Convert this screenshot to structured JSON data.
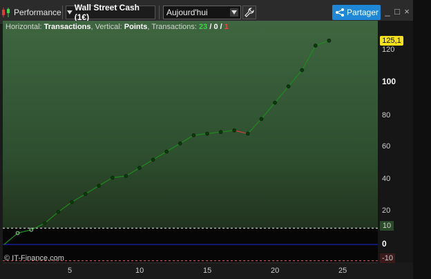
{
  "toolbar": {
    "performance_label": "Performance",
    "instrument_label": "Wall Street Cash (1€)",
    "period_label": "Aujourd'hui",
    "share_label": "Partager"
  },
  "info": {
    "horizontal_prefix": "Horizontal: ",
    "horizontal_value": "Transactions",
    "vertical_prefix": ", Vertical: ",
    "vertical_value": "Points",
    "transactions_prefix": ", Transactions: ",
    "count_green": "23",
    "sep1": " / ",
    "count_white": "0",
    "sep2": " / ",
    "count_red": "1"
  },
  "copyright": "© IT-Finance.com",
  "chart_data": {
    "type": "line",
    "xlabel": "",
    "ylabel": "",
    "xlim": [
      0,
      28
    ],
    "ylim": [
      -11,
      136
    ],
    "x_ticks": [
      "5",
      "10",
      "15",
      "20",
      "25"
    ],
    "y_ticks": [
      "120",
      "100",
      "80",
      "60",
      "40",
      "20",
      "0",
      "10",
      "-10"
    ],
    "current_value_label": "125,1",
    "threshold_upper": 10,
    "threshold_lower": -10,
    "zero_line": 0,
    "series": [
      {
        "x": [
          0,
          1,
          2,
          3,
          4,
          5,
          6,
          7,
          8,
          9,
          10,
          11,
          12,
          13,
          14,
          15,
          16,
          17,
          18,
          19,
          20,
          21,
          22,
          23,
          24
        ],
        "y": [
          0,
          7,
          9,
          13,
          20,
          26,
          31,
          36,
          41,
          42,
          47,
          52,
          57,
          62,
          67,
          68,
          69,
          70,
          68,
          77,
          87,
          97,
          107,
          122,
          125.1
        ],
        "colors": [
          "green",
          "green",
          "green",
          "green",
          "green",
          "green",
          "green",
          "green",
          "green",
          "green",
          "green",
          "green",
          "green",
          "green",
          "green",
          "green",
          "green",
          "red",
          "green",
          "green",
          "green",
          "green",
          "green",
          "green"
        ]
      }
    ]
  },
  "colors": {
    "line_green": "#1f8a1f",
    "line_red": "#d43c3c",
    "marker": "#0d3a0d",
    "zero_line": "#1d2bdf",
    "badge_yellow": "#f5e11a",
    "share_blue": "#1e88d6"
  }
}
